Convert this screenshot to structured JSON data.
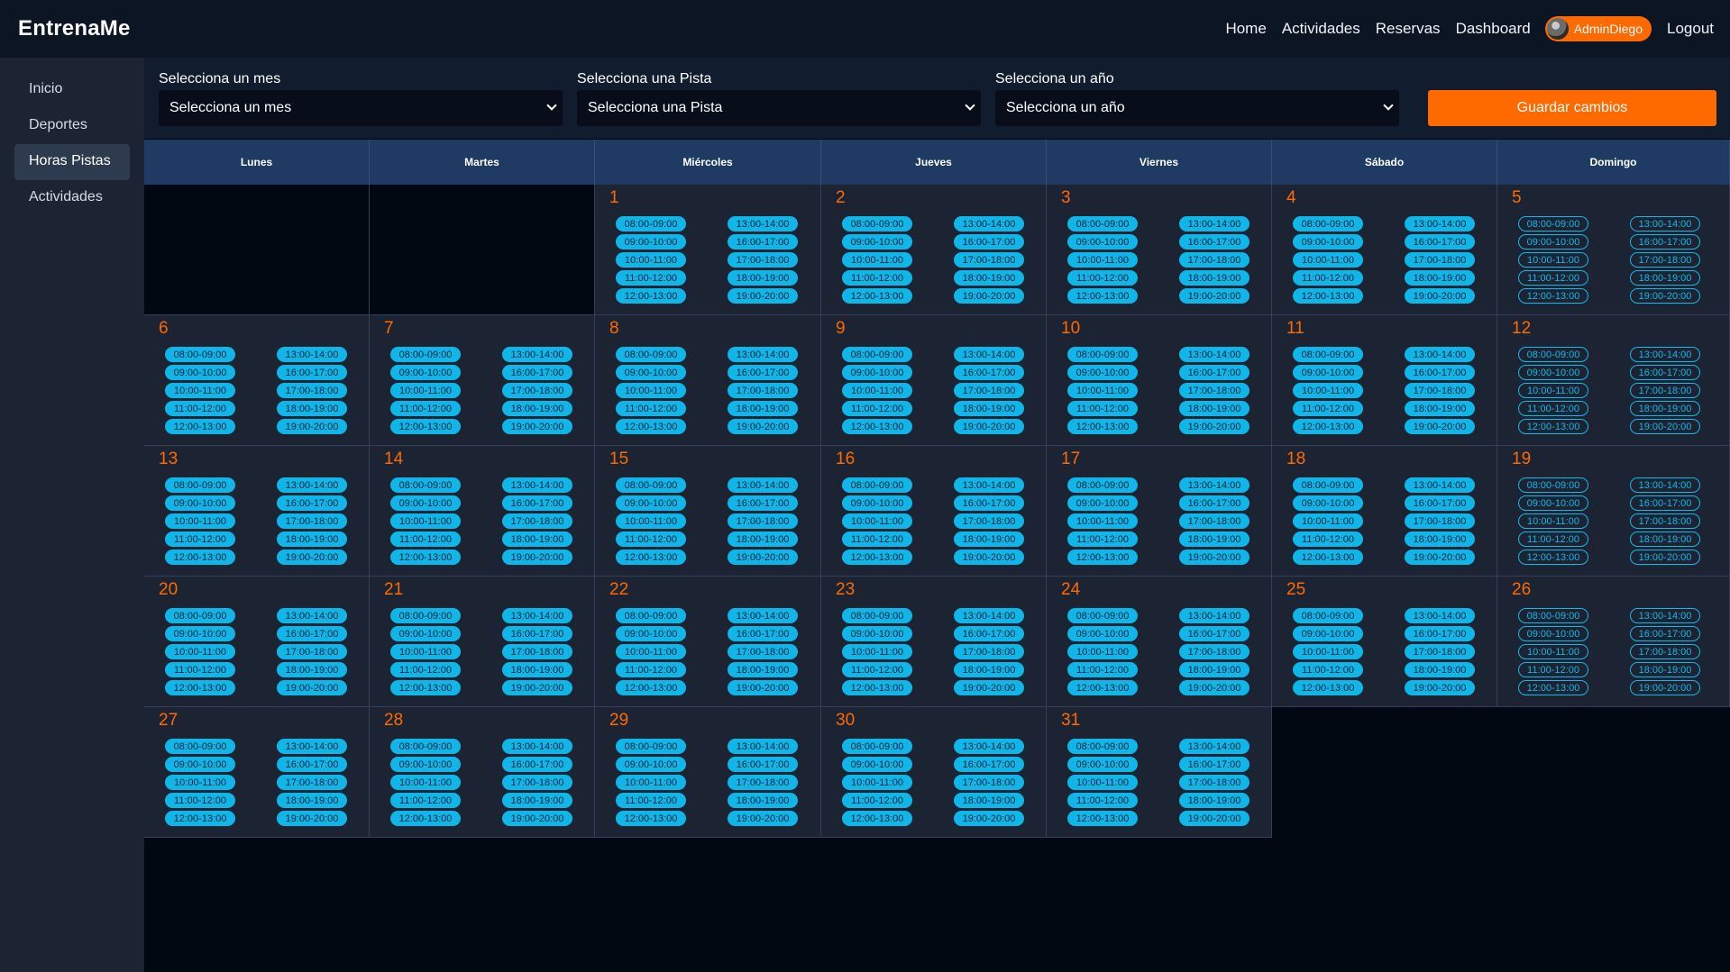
{
  "app": {
    "brand": "EntrenaMe"
  },
  "nav": {
    "links": [
      "Home",
      "Actividades",
      "Reservas",
      "Dashboard"
    ],
    "user": "AdminDiego",
    "logout": "Logout"
  },
  "sidebar": {
    "items": [
      {
        "label": "Inicio",
        "active": false
      },
      {
        "label": "Deportes",
        "active": false
      },
      {
        "label": "Horas Pistas",
        "active": true
      },
      {
        "label": "Actividades",
        "active": false
      }
    ]
  },
  "filters": {
    "month": {
      "label": "Selecciona un mes",
      "value": "Selecciona un mes"
    },
    "court": {
      "label": "Selecciona una Pista",
      "value": "Selecciona una Pista"
    },
    "year": {
      "label": "Selecciona un año",
      "value": "Selecciona un año"
    },
    "save_label": "Guardar cambios"
  },
  "calendar": {
    "weekdays": [
      "Lunes",
      "Martes",
      "Miércoles",
      "Jueves",
      "Viernes",
      "Sábado",
      "Domingo"
    ],
    "first_weekday_index": 2,
    "days_in_month": 31,
    "slots_col1": [
      "08:00-09:00",
      "09:00-10:00",
      "10:00-11:00",
      "11:00-12:00",
      "12:00-13:00"
    ],
    "slots_col2": [
      "13:00-14:00",
      "16:00-17:00",
      "17:00-18:00",
      "18:00-19:00",
      "19:00-20:00"
    ]
  },
  "colors": {
    "accent": "#ff6a00",
    "slot": "#11b6e8",
    "header": "#1f3b63",
    "topbar": "#0b1524"
  }
}
